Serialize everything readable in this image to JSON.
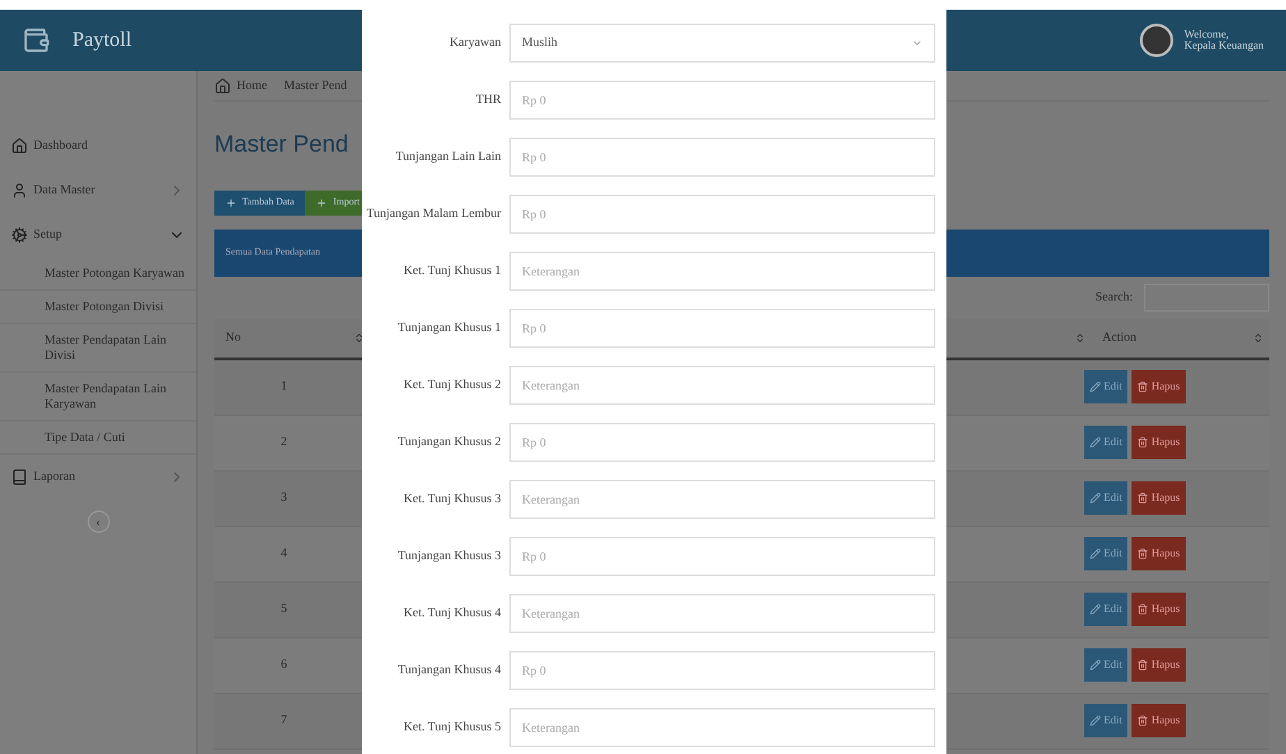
{
  "header": {
    "brand": "Paytoll",
    "user_greeting": "Welcome,",
    "user_name": "Kepala Keuangan"
  },
  "breadcrumb": [
    {
      "label": "Home"
    },
    {
      "label": "Master Pend"
    }
  ],
  "sidebar": {
    "items": [
      {
        "label": "Dashboard",
        "kind": "link"
      },
      {
        "label": "Data Master",
        "kind": "group",
        "expanded": false
      },
      {
        "label": "Setup",
        "kind": "group",
        "expanded": true,
        "children": [
          {
            "label": "Master Potongan Karyawan"
          },
          {
            "label": "Master Potongan Divisi"
          },
          {
            "label": "Master Pendapatan Lain Divisi"
          },
          {
            "label": "Master Pendapatan Lain Karyawan"
          },
          {
            "label": "Tipe Data / Cuti"
          }
        ]
      },
      {
        "label": "Laporan",
        "kind": "group",
        "expanded": false
      }
    ],
    "collapse_button": "‹"
  },
  "page": {
    "title": "Master Pend",
    "buttons": [
      {
        "label": "Tambah Data",
        "kind": "primary"
      },
      {
        "label": "Import",
        "kind": "success"
      }
    ],
    "panel_title": "Semua Data Pendapatan",
    "search_label": "Search:",
    "table": {
      "columns": [
        {
          "label": "No"
        },
        {
          "label": "Action"
        }
      ],
      "rows": [
        {
          "no": "1",
          "edit": "Edit",
          "delete": "Hapus"
        },
        {
          "no": "2",
          "edit": "Edit",
          "delete": "Hapus"
        },
        {
          "no": "3",
          "edit": "Edit",
          "delete": "Hapus"
        },
        {
          "no": "4",
          "edit": "Edit",
          "delete": "Hapus"
        },
        {
          "no": "5",
          "edit": "Edit",
          "delete": "Hapus"
        },
        {
          "no": "6",
          "edit": "Edit",
          "delete": "Hapus"
        },
        {
          "no": "7",
          "edit": "Edit",
          "delete": "Hapus"
        }
      ]
    }
  },
  "modal": {
    "fields": [
      {
        "label": "Karyawan",
        "kind": "select",
        "value": "Muslih"
      },
      {
        "label": "THR",
        "kind": "input",
        "placeholder": "Rp 0"
      },
      {
        "label": "Tunjangan Lain Lain",
        "kind": "input",
        "placeholder": "Rp 0"
      },
      {
        "label": "Tunjangan Malam Lembur",
        "kind": "input",
        "placeholder": "Rp 0"
      },
      {
        "label": "Ket. Tunj Khusus 1",
        "kind": "input",
        "placeholder": "Keterangan"
      },
      {
        "label": "Tunjangan Khusus 1",
        "kind": "input",
        "placeholder": "Rp 0"
      },
      {
        "label": "Ket. Tunj Khusus 2",
        "kind": "input",
        "placeholder": "Keterangan"
      },
      {
        "label": "Tunjangan Khusus 2",
        "kind": "input",
        "placeholder": "Rp 0"
      },
      {
        "label": "Ket. Tunj Khusus 3",
        "kind": "input",
        "placeholder": "Keterangan"
      },
      {
        "label": "Tunjangan Khusus 3",
        "kind": "input",
        "placeholder": "Rp 0"
      },
      {
        "label": "Ket. Tunj Khusus 4",
        "kind": "input",
        "placeholder": "Keterangan"
      },
      {
        "label": "Tunjangan Khusus 4",
        "kind": "input",
        "placeholder": "Rp 0"
      },
      {
        "label": "Ket. Tunj Khusus 5",
        "kind": "input",
        "placeholder": "Keterangan"
      }
    ]
  }
}
